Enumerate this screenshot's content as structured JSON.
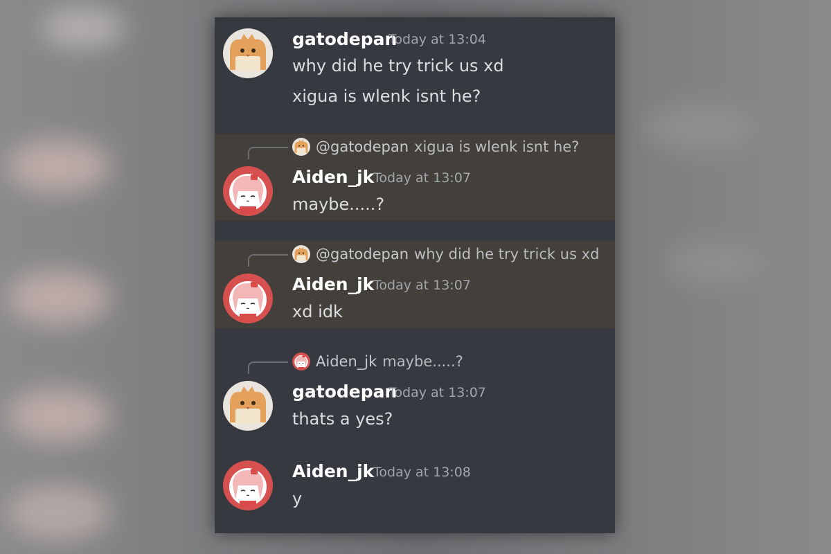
{
  "messages": [
    {
      "author": "gatodepan",
      "avatar": "cat-bread-avatar",
      "timestamp": "Today at 13:04",
      "lines": [
        "why did he try trick us xd",
        "xigua is wlenk isnt he?"
      ]
    },
    {
      "author": "Aiden_jk",
      "avatar": "anime-girl-avatar",
      "timestamp": "Today at 13:07",
      "highlighted": true,
      "reply_to": {
        "name": "@gatodepan",
        "text": "xigua is wlenk isnt he?"
      },
      "lines": [
        "maybe.....?"
      ]
    },
    {
      "author": "Aiden_jk",
      "avatar": "anime-girl-avatar",
      "timestamp": "Today at 13:07",
      "highlighted": true,
      "reply_to": {
        "name": "@gatodepan",
        "text": "why did he try trick us xd"
      },
      "lines": [
        "xd idk"
      ]
    },
    {
      "author": "gatodepan",
      "avatar": "cat-bread-avatar",
      "timestamp": "Today at 13:07",
      "reply_to": {
        "name": "Aiden_jk",
        "text": "maybe.....?"
      },
      "lines": [
        "thats a yes?"
      ]
    },
    {
      "author": "Aiden_jk",
      "avatar": "anime-girl-avatar",
      "timestamp": "Today at 13:08",
      "lines": [
        "y"
      ]
    }
  ],
  "colors": {
    "panel_bg": "#36393f",
    "highlight_bg": "#433f3b",
    "username": "#ffffff",
    "timestamp": "#a3a6aa",
    "message_text": "#dcddde"
  }
}
